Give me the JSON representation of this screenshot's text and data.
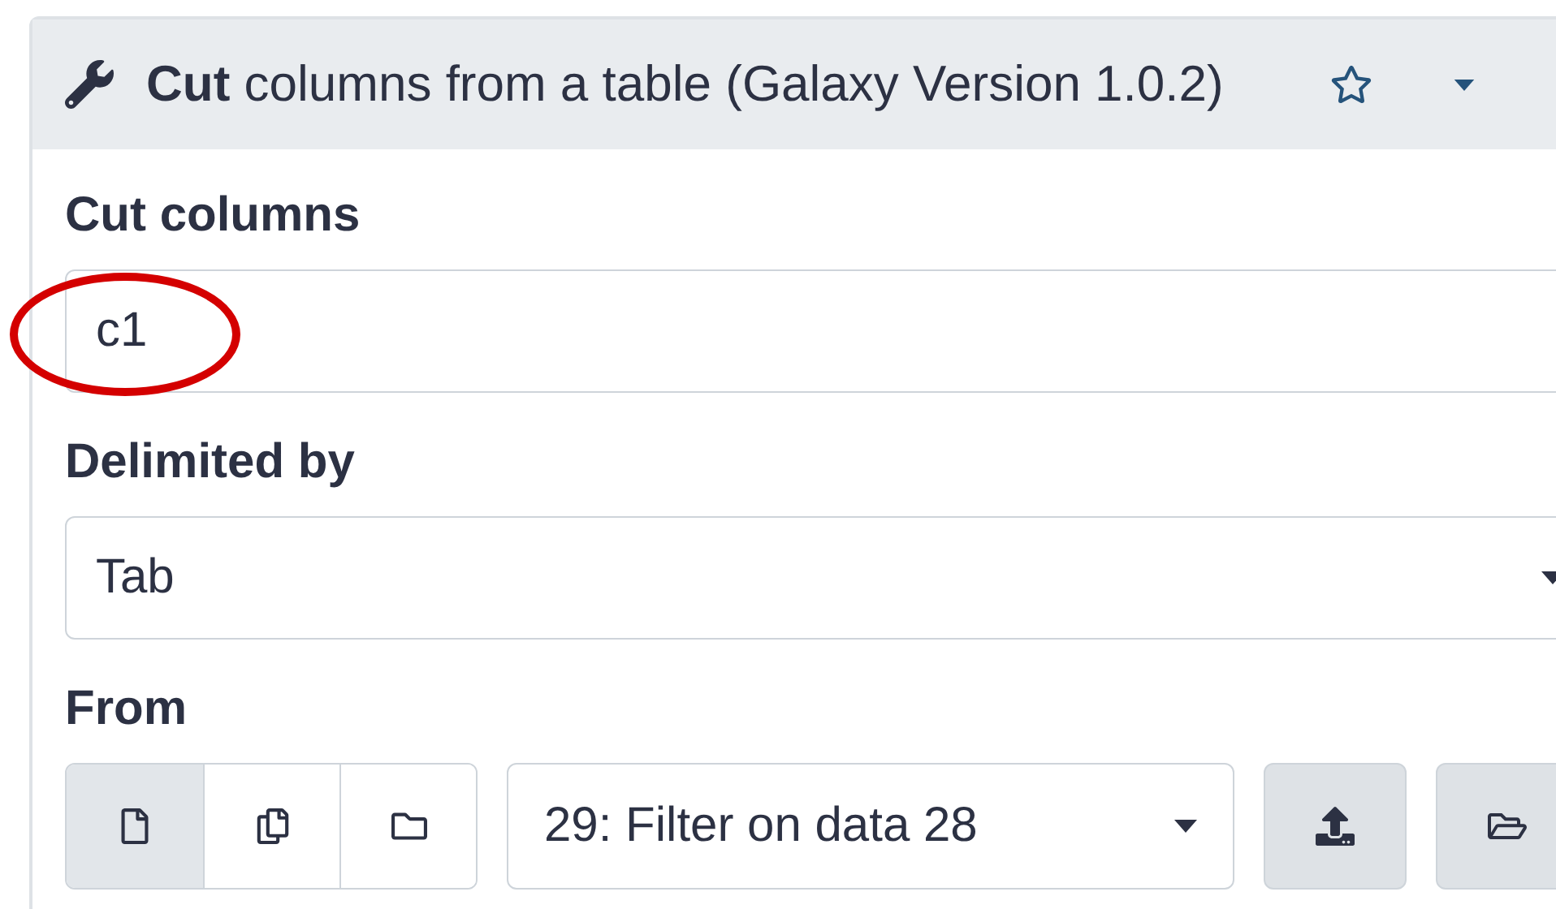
{
  "tool": {
    "title": "**Cut** columns from a table (Galaxy Version 1.0.2)",
    "favorite": false
  },
  "fields": [
    {
      "kind": "text",
      "label": "Cut columns",
      "value": "c1",
      "highlighted": true
    },
    {
      "kind": "select",
      "label": "Delimited by",
      "value": "Tab"
    },
    {
      "kind": "data",
      "label": "From",
      "modes": [
        {
          "selected": true
        },
        {
          "selected": false
        },
        {
          "selected": false
        }
      ],
      "value": "29: Filter on data 28"
    }
  ]
}
